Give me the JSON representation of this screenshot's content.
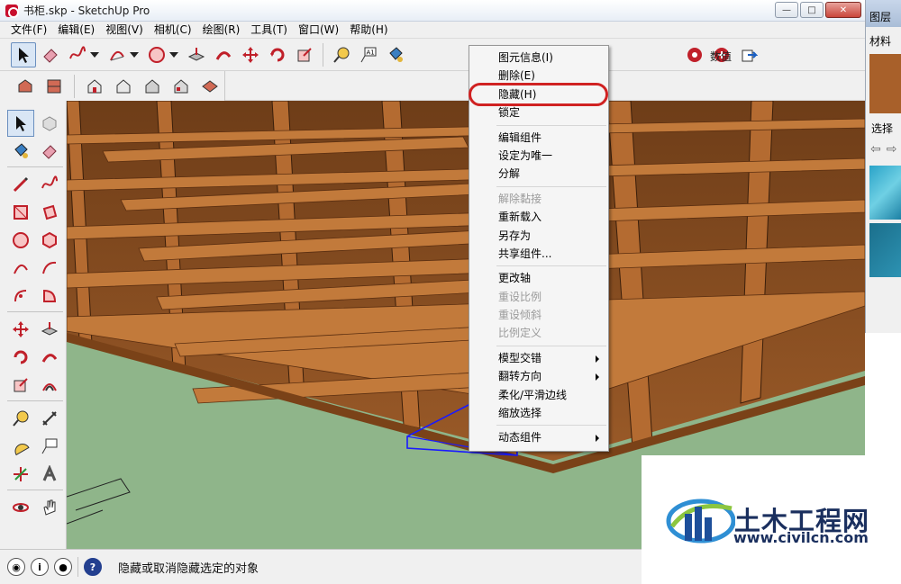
{
  "window": {
    "title": "书柜.skp - SketchUp Pro",
    "minimize": "—",
    "maximize": "□",
    "close": "✕"
  },
  "menubar": [
    {
      "label": "文件(F)"
    },
    {
      "label": "编辑(E)"
    },
    {
      "label": "视图(V)"
    },
    {
      "label": "相机(C)"
    },
    {
      "label": "绘图(R)"
    },
    {
      "label": "工具(T)"
    },
    {
      "label": "窗口(W)"
    },
    {
      "label": "帮助(H)"
    }
  ],
  "toolbar": {
    "numeric_label": "数值",
    "text_tool_glyph": "A1"
  },
  "context_menu": {
    "items": [
      {
        "label": "图元信息(I)",
        "enabled": true
      },
      {
        "label": "删除(E)",
        "enabled": true
      },
      {
        "label": "隐藏(H)",
        "enabled": true,
        "highlighted": true
      },
      {
        "label": "锁定",
        "enabled": true
      },
      {
        "separator": true
      },
      {
        "label": "编辑组件",
        "enabled": true
      },
      {
        "label": "设定为唯一",
        "enabled": true
      },
      {
        "label": "分解",
        "enabled": true
      },
      {
        "separator": true
      },
      {
        "label": "解除黏接",
        "enabled": false
      },
      {
        "label": "重新载入",
        "enabled": true
      },
      {
        "label": "另存为",
        "enabled": true
      },
      {
        "label": "共享组件...",
        "enabled": true
      },
      {
        "separator": true
      },
      {
        "label": "更改轴",
        "enabled": true
      },
      {
        "label": "重设比例",
        "enabled": false
      },
      {
        "label": "重设倾斜",
        "enabled": false
      },
      {
        "label": "比例定义",
        "enabled": false
      },
      {
        "separator": true
      },
      {
        "label": "模型交错",
        "enabled": true,
        "submenu": true
      },
      {
        "label": "翻转方向",
        "enabled": true,
        "submenu": true
      },
      {
        "label": "柔化/平滑边线",
        "enabled": true
      },
      {
        "label": "缩放选择",
        "enabled": true
      },
      {
        "separator": true
      },
      {
        "label": "动态组件",
        "enabled": true,
        "submenu": true
      }
    ]
  },
  "tray": {
    "layers_title": "图层",
    "materials_tab": "材料",
    "select_label": "选择"
  },
  "statusbar": {
    "help_icon": "?",
    "info_icon": "i",
    "message": "隐藏或取消隐藏选定的对象"
  },
  "watermark": {
    "name": "土木工程网",
    "url": "www.civilcn.com"
  },
  "colors": {
    "accent": "#d02222",
    "wood": "#a8602a",
    "ground": "#8fb58a",
    "selection": "#1a1aff"
  }
}
